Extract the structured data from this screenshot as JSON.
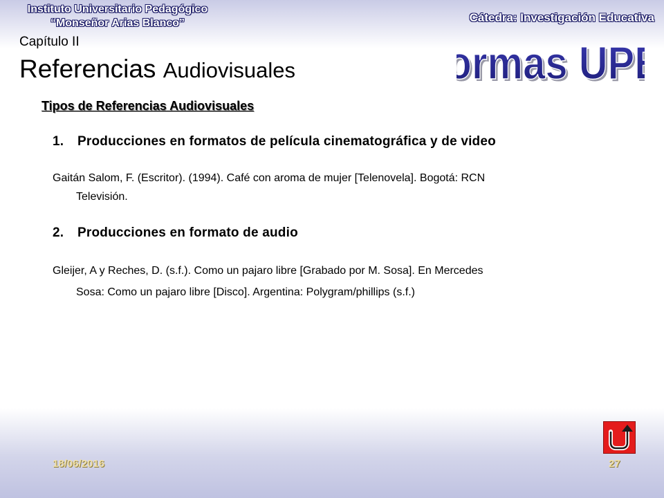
{
  "header": {
    "institution_line1": "Instituto Universitario Pedagógico",
    "institution_line2": "“Monseñor Arias Blanco”",
    "catedra": "Cátedra: Investigación Educativa",
    "logo_text": "Normas UPEL"
  },
  "title": {
    "chapter": "Capítulo II",
    "main_part1": "Referencias ",
    "main_part2": "Audiovisuales"
  },
  "content": {
    "section_heading": "Tipos de Referencias Audiovisuales",
    "items": [
      {
        "number": "1.",
        "heading": "Producciones en formatos de película cinematográfica y de video",
        "reference_line1": "Gaitán Salom, F. (Escritor). (1994). Café con aroma de mujer [Telenovela]. Bogotá: RCN",
        "reference_line2": "Televisión."
      },
      {
        "number": "2.",
        "heading": "Producciones en formato de audio",
        "reference_line1": "Gleijer, A y Reches, D. (s.f.). Como un pajaro libre [Grabado por M. Sosa]. En Mercedes",
        "reference_line2": "Sosa: Como un pajaro libre [Disco]. Argentina: Polygram/phillips (s.f.)"
      }
    ]
  },
  "footer": {
    "date": "18/06/2016",
    "page_number": "27",
    "return_icon": "u-turn-arrow-icon"
  },
  "colors": {
    "header_text_outline": "#1a1a66",
    "logo_fill": "#2a2a9a",
    "footer_text": "#f0e0a8",
    "return_button": "#e41c1c"
  }
}
